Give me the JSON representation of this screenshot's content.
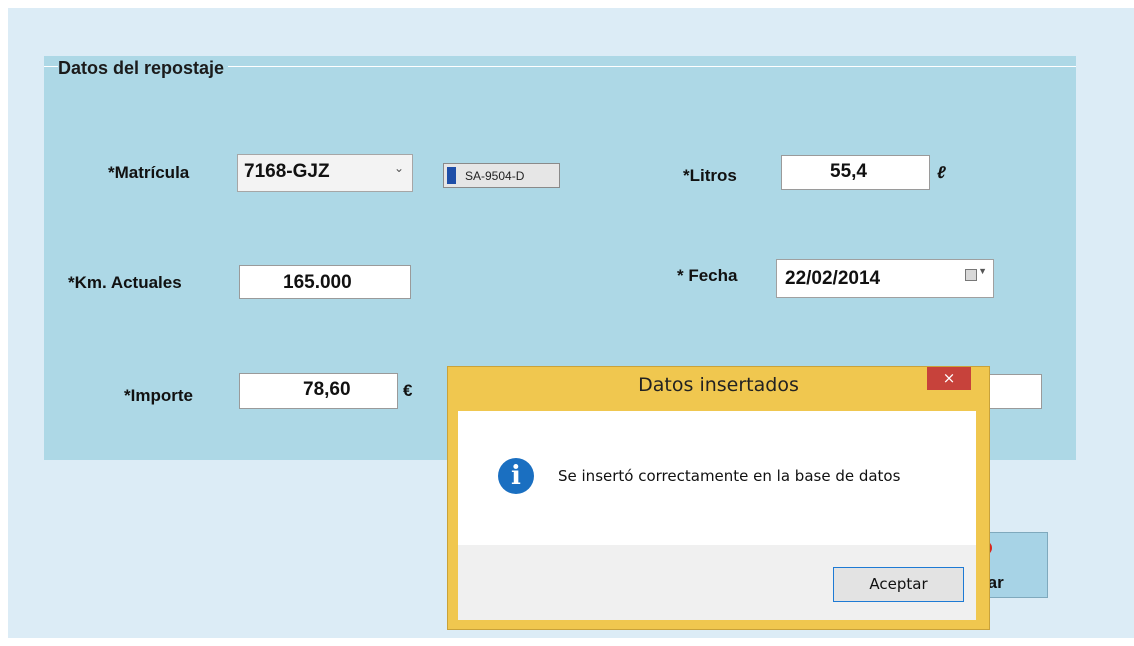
{
  "form": {
    "group_title": "Datos del repostaje",
    "matricula": {
      "label": "*Matrícula",
      "value": "7168-GJZ"
    },
    "plate_badge": "SA-9504-D",
    "km": {
      "label": "*Km. Actuales",
      "value": "165.000"
    },
    "importe": {
      "label": "*Importe",
      "value": "78,60",
      "unit": "€"
    },
    "litros": {
      "label": "*Litros",
      "value": "55,4",
      "unit": "ℓ"
    },
    "fecha": {
      "label": "* Fecha",
      "value": "22/02/2014"
    },
    "cancel_button_label": "celar"
  },
  "dialog": {
    "title": "Datos insertados",
    "close_glyph": "×",
    "icon": "info-icon",
    "message": "Se insertó correctamente en la base de datos",
    "ok_label": "Aceptar"
  },
  "colors": {
    "app_background": "#dcecf6",
    "group_background": "#add8e6",
    "dialog_frame": "#f0c74f",
    "close_button": "#c7423b",
    "info_icon": "#1a6fc1"
  }
}
